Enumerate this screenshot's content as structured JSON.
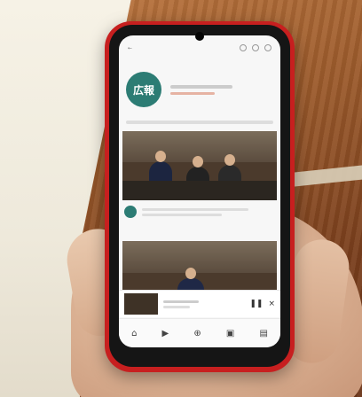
{
  "phone_screen": {
    "channel_avatar_text": "広報"
  },
  "bottom_nav": {
    "icons": [
      "home-icon",
      "shorts-icon",
      "add-icon",
      "subscriptions-icon",
      "library-icon"
    ]
  },
  "colors": {
    "phone_case": "#c71f1f",
    "channel_accent": "#2c7c74",
    "wood": "#8a4b22"
  }
}
